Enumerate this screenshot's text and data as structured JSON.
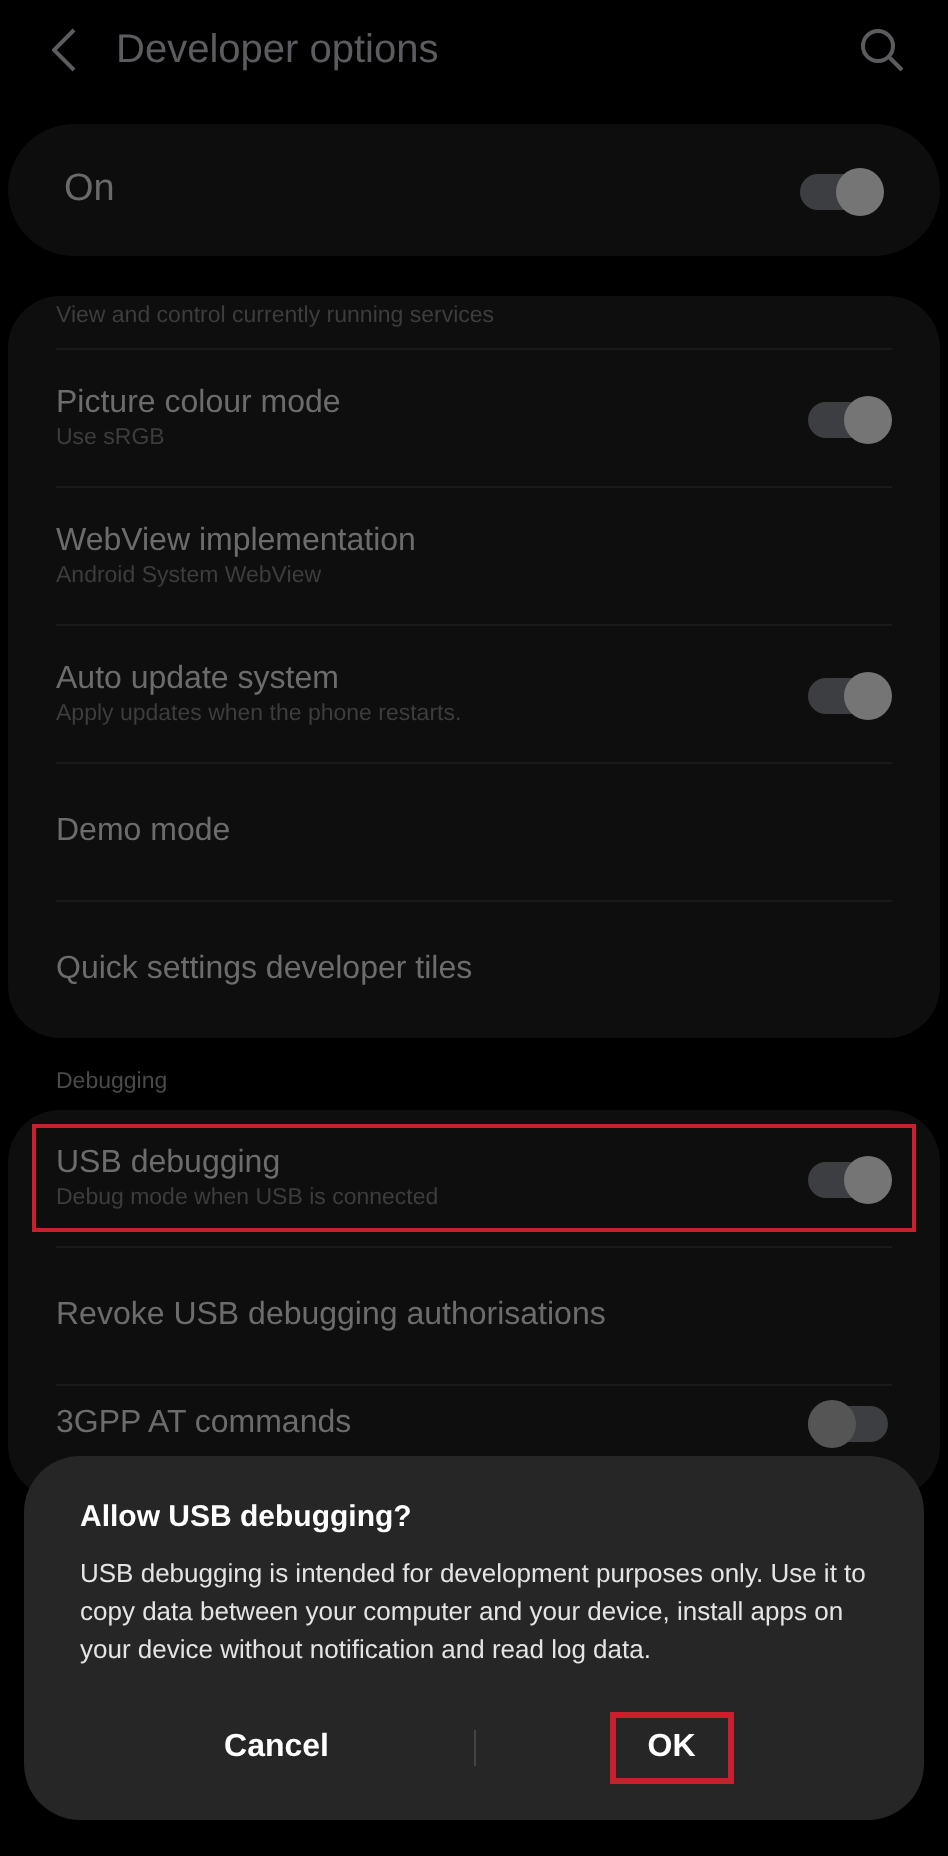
{
  "header": {
    "title": "Developer options"
  },
  "master": {
    "label": "On",
    "on": true
  },
  "groups": [
    {
      "items": [
        {
          "kind": "text",
          "subtitle": "View and control currently running services"
        },
        {
          "kind": "toggle",
          "title": "Picture colour mode",
          "subtitle": "Use sRGB",
          "on": true
        },
        {
          "kind": "text",
          "title": "WebView implementation",
          "subtitle": "Android System WebView"
        },
        {
          "kind": "toggle",
          "title": "Auto update system",
          "subtitle": "Apply updates when the phone restarts.",
          "on": true
        },
        {
          "kind": "text",
          "title": "Demo mode"
        },
        {
          "kind": "text",
          "title": "Quick settings developer tiles"
        }
      ]
    },
    {
      "heading": "Debugging",
      "items": [
        {
          "kind": "toggle",
          "title": "USB debugging",
          "subtitle": "Debug mode when USB is connected",
          "on": true,
          "highlighted": true
        },
        {
          "kind": "text",
          "title": "Revoke USB debugging authorisations"
        },
        {
          "kind": "toggle",
          "title": "3GPP AT commands",
          "on": false
        }
      ]
    }
  ],
  "dialog": {
    "title": "Allow USB debugging?",
    "message": "USB debugging is intended for development purposes only. Use it to copy data between your computer and your device, install apps on your device without notification and read log data.",
    "buttons": [
      {
        "label": "Cancel",
        "highlighted": false
      },
      {
        "label": "OK",
        "highlighted": true
      }
    ]
  }
}
